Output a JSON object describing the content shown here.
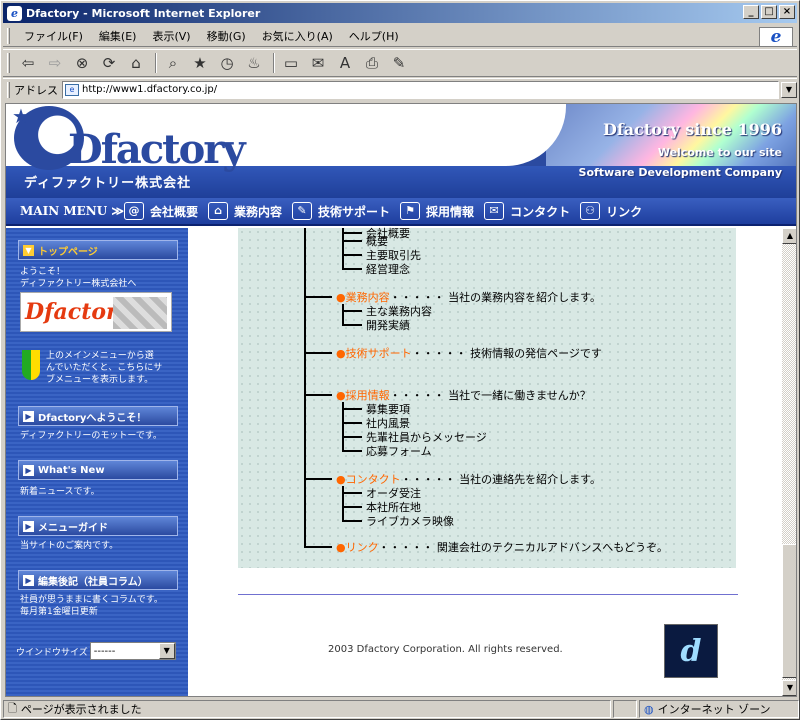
{
  "window": {
    "title": "Dfactory - Microsoft Internet Explorer",
    "min": "_",
    "max": "□",
    "close": "×"
  },
  "menubar": [
    "ファイル(F)",
    "編集(E)",
    "表示(V)",
    "移動(G)",
    "お気に入り(A)",
    "ヘルプ(H)"
  ],
  "address": {
    "label": "アドレス",
    "url": "http://www1.dfactory.co.jp/"
  },
  "banner": {
    "logo": "Dfactory",
    "company": "ディファクトリー株式会社",
    "since": "Dfactory since 1996",
    "welcome": "Welcome to our site",
    "tagline": "Software Development Company"
  },
  "mainmenu": {
    "title": "MAIN MENU ≫",
    "items": [
      {
        "icon": "@",
        "label": "会社概要"
      },
      {
        "icon": "⌂",
        "label": "業務内容"
      },
      {
        "icon": "✎",
        "label": "技術サポート"
      },
      {
        "icon": "⚑",
        "label": "採用情報"
      },
      {
        "icon": "✉",
        "label": "コンタクト"
      },
      {
        "icon": "⚇",
        "label": "リンク"
      }
    ]
  },
  "sidebar": {
    "top_button": "トップページ",
    "welcome_text_1": "ようこそ！",
    "welcome_text_2": "ディファクトリー株式会社へ",
    "logo_small": "Dfactory",
    "leaf_text_1": "上のメインメニューから選",
    "leaf_text_2": "んでいただくと、こちらにサ",
    "leaf_text_3": "ブメニューを表示します。",
    "btn_welcome": "Dfactoryへようこそ！",
    "btn_welcome_desc": "ディファクトリーのモットーです。",
    "btn_news": "What's New",
    "btn_news_desc": "新着ニュースです。",
    "btn_guide": "メニューガイド",
    "btn_guide_desc": "当サイトのご案内です。",
    "btn_column": "編集後記（社員コラム）",
    "btn_column_desc_1": "社員が思うままに書くコラムです。",
    "btn_column_desc_2": "毎月第1金曜日更新",
    "winsize_label": "ウインドウサイズ",
    "winsize_value": "------"
  },
  "tree": {
    "top_partial": "会社概要",
    "sub_a1": "概要",
    "sub_a2": "主要取引先",
    "sub_a3": "経営理念",
    "business_link": "業務内容",
    "business_desc": "・・・・・ 当社の業務内容を紹介します。",
    "sub_b1": "主な業務内容",
    "sub_b2": "開発実績",
    "support_link": "技術サポート",
    "support_desc": "・・・・・ 技術情報の発信ページです",
    "recruit_link": "採用情報",
    "recruit_desc": "・・・・・ 当社で一緒に働きませんか？",
    "sub_c1": "募集要項",
    "sub_c2": "社内風景",
    "sub_c3": "先輩社員からメッセージ",
    "sub_c4": "応募フォーム",
    "contact_link": "コンタクト",
    "contact_desc": "・・・・・ 当社の連絡先を紹介します。",
    "sub_d1": "オーダ受注",
    "sub_d2": "本社所在地",
    "sub_d3": "ライブカメラ映像",
    "link_link": "リンク",
    "link_desc": "・・・・・ 関連会社のテクニカルアドバンスへもどうぞ。"
  },
  "footer": {
    "copyright": "2003 Dfactory Corporation. All rights reserved.",
    "logo": "d"
  },
  "status": {
    "left": "ページが表示されました",
    "zone": "インターネット ゾーン"
  }
}
